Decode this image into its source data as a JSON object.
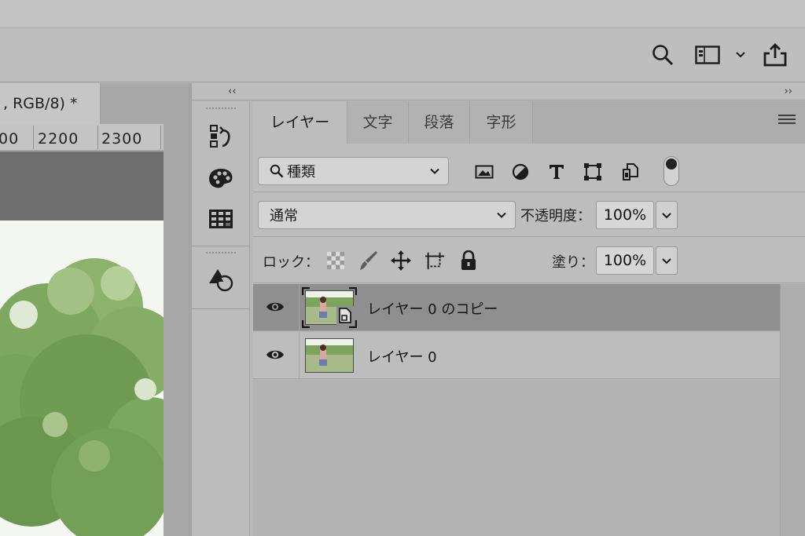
{
  "document": {
    "tab_title": ", RGB/8) *",
    "ruler_ticks": [
      "00",
      "2200",
      "2300"
    ]
  },
  "toolbar": {
    "icons": [
      "search-icon",
      "workspace-icon",
      "chevron-down-icon",
      "share-icon"
    ]
  },
  "panel": {
    "collapse_left": "‹‹",
    "collapse_right": "››",
    "tabs": [
      {
        "label": "レイヤー",
        "active": true
      },
      {
        "label": "文字",
        "active": false
      },
      {
        "label": "段落",
        "active": false
      },
      {
        "label": "字形",
        "active": false
      }
    ],
    "filter": {
      "selected": "種類",
      "icons": [
        "image-filter-icon",
        "adjustment-filter-icon",
        "type-filter-icon",
        "shape-filter-icon",
        "smart-object-filter-icon",
        "filter-toggle"
      ]
    },
    "blend_mode": "通常",
    "opacity": {
      "label": "不透明度：",
      "value": "100%"
    },
    "lock": {
      "label": "ロック：",
      "icons": [
        "lock-transparent-icon",
        "lock-paint-icon",
        "lock-position-icon",
        "lock-artboard-icon",
        "lock-all-icon"
      ]
    },
    "fill": {
      "label": "塗り：",
      "value": "100%"
    }
  },
  "layers": [
    {
      "name": "レイヤー 0 のコピー",
      "selected": true,
      "smart_object": true
    },
    {
      "name": "レイヤー 0",
      "selected": false,
      "smart_object": false
    }
  ],
  "colors": {
    "ui_bg": "#bdbdbd",
    "selected_row": "#8f8f8f",
    "canvas_gray": "#6e6e6e",
    "foliage": "#7aa35c"
  }
}
